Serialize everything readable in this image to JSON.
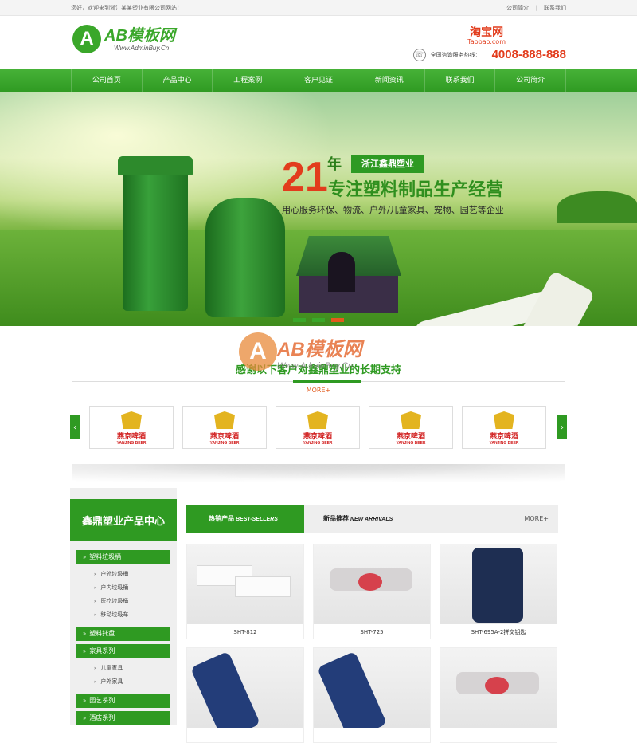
{
  "topbar": {
    "welcome": "您好，欢迎来到浙江某某塑业有限公司网站！",
    "link1": "公司简介",
    "link2": "联系我们"
  },
  "header": {
    "logo_badge": "A",
    "logo_main": "AB模板网",
    "logo_sub": "Www.AdminBuy.Cn",
    "taobao_cn": "淘宝网",
    "taobao_en": "Taobao.com",
    "hotline_label": "全国咨询服务热线：",
    "hotline_number": "4008-888-888"
  },
  "nav": [
    "公司首页",
    "产品中心",
    "工程案例",
    "客户见证",
    "新闻资讯",
    "联系我们",
    "公司简介"
  ],
  "banner": {
    "years": "21",
    "nian": "年",
    "company": "浙江鑫鼎塑业",
    "slogan": "专注塑料制品生产经营",
    "sub": "用心服务环保、物流、户外/儿童家具、宠物、园艺等企业"
  },
  "partners_section": {
    "title": "感谢以下客户对鑫鼎塑业的长期支持",
    "more": "MORE+",
    "watermark_main": "AB模板网",
    "watermark_sub": "Www.AdminBuy.Cn",
    "items": [
      {
        "brand": "燕京啤酒",
        "brand_en": "YANJING BEER"
      },
      {
        "brand": "燕京啤酒",
        "brand_en": "YANJING BEER"
      },
      {
        "brand": "燕京啤酒",
        "brand_en": "YANJING BEER"
      },
      {
        "brand": "燕京啤酒",
        "brand_en": "YANJING BEER"
      },
      {
        "brand": "燕京啤酒",
        "brand_en": "YANJING BEER"
      }
    ]
  },
  "sidebar": {
    "title": "鑫鼎塑业产品中心",
    "cats": [
      {
        "label": "塑料垃圾桶",
        "subs": [
          "户外垃圾桶",
          "户内垃圾桶",
          "医疗垃圾桶",
          "移动垃圾车"
        ]
      },
      {
        "label": "塑料托盘",
        "subs": []
      },
      {
        "label": "家具系列",
        "subs": [
          "儿童家具",
          "户外家具"
        ]
      },
      {
        "label": "园艺系列",
        "subs": []
      },
      {
        "label": "酒店系列",
        "subs": []
      }
    ]
  },
  "products": {
    "tab_hot": "热销产品",
    "tab_hot_en": "BEST-SELLERS",
    "tab_new": "新品推荐",
    "tab_new_en": "NEW ARRIVALS",
    "more": "MORE+",
    "items": [
      {
        "name": "SHT-812"
      },
      {
        "name": "SHT-725"
      },
      {
        "name": "SHT-695A-2拼交钥匙"
      },
      {
        "name": ""
      },
      {
        "name": ""
      },
      {
        "name": ""
      }
    ]
  },
  "colors": {
    "brand_green": "#2f9a22",
    "accent_red": "#e23c1c"
  }
}
